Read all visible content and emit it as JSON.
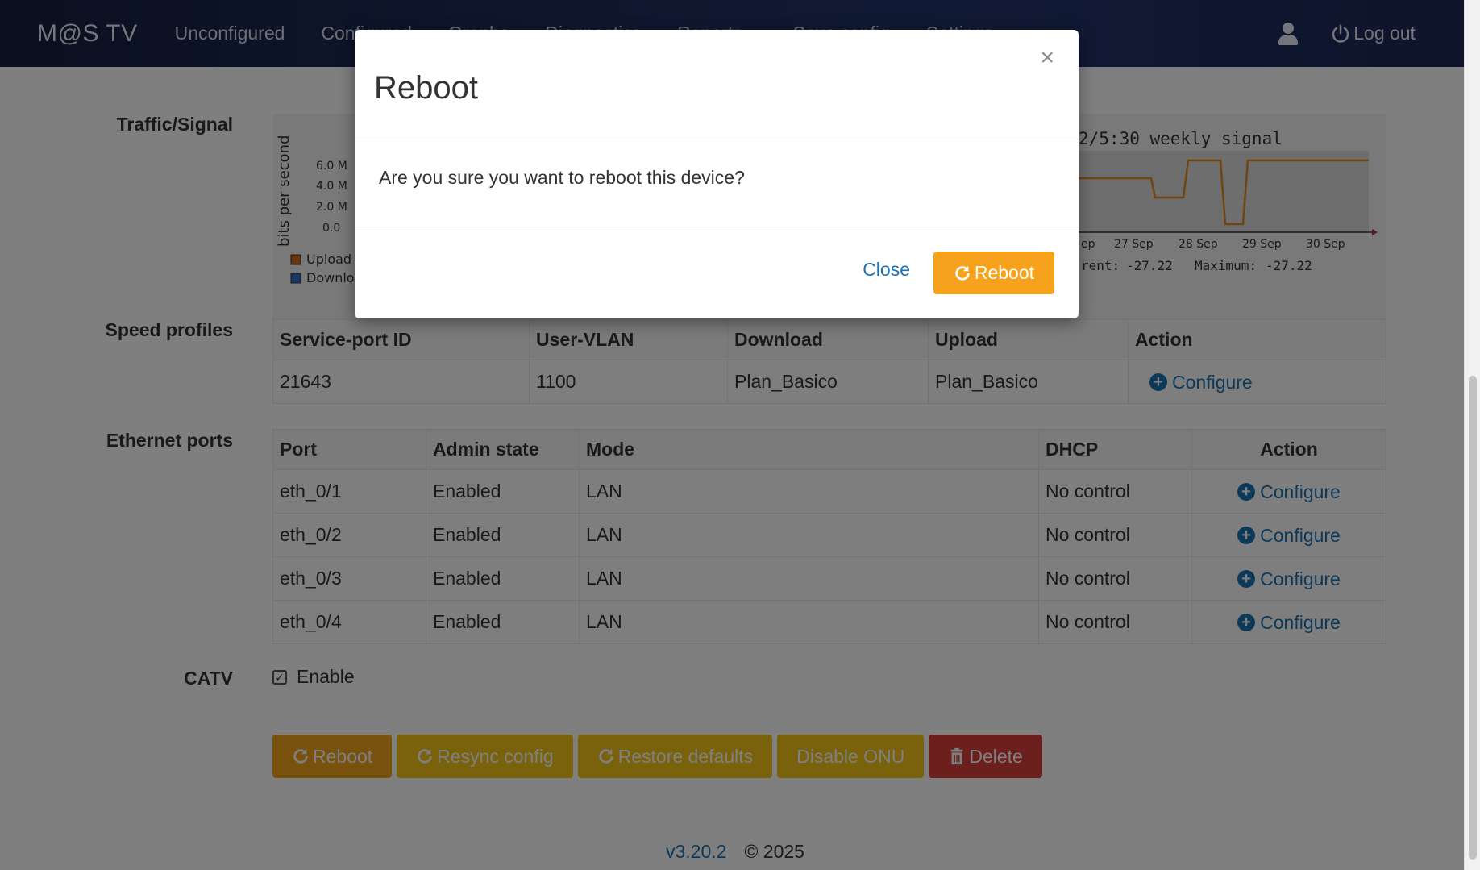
{
  "navbar": {
    "brand": "M@S TV",
    "items": [
      "Unconfigured",
      "Configured",
      "Graphs",
      "Diagnostics",
      "Reports",
      "Save config",
      "Settings"
    ],
    "logout": "Log out"
  },
  "sections": {
    "traffic_label": "Traffic/Signal",
    "speed_label": "Speed profiles",
    "ethernet_label": "Ethernet ports",
    "catv_label": "CATV"
  },
  "traffic_graph": {
    "ylabel": "bits per second",
    "yticks": [
      "6.0 M",
      "4.0 M",
      "2.0 M",
      "0.0"
    ],
    "legend": [
      "Upload",
      "Download"
    ],
    "upload_color": "#d86c1a",
    "download_color": "#3a6fc9"
  },
  "signal_graph": {
    "title_fragment": "2/5:30 weekly signal",
    "xticks": [
      "ep",
      "27 Sep",
      "28 Sep",
      "29 Sep",
      "30 Sep"
    ],
    "current_label": "rent:",
    "current_value": "-27.22",
    "maximum_label": "Maximum:",
    "maximum_value": "-27.22",
    "line_color": "#e28a1e"
  },
  "speed_profiles": {
    "headers": [
      "Service-port ID",
      "User-VLAN",
      "Download",
      "Upload",
      "Action"
    ],
    "rows": [
      {
        "id": "21643",
        "vlan": "1100",
        "download": "Plan_Basico",
        "upload": "Plan_Basico",
        "action": "Configure"
      }
    ]
  },
  "ethernet_ports": {
    "headers": [
      "Port",
      "Admin state",
      "Mode",
      "DHCP",
      "Action"
    ],
    "rows": [
      {
        "port": "eth_0/1",
        "state": "Enabled",
        "mode": "LAN",
        "dhcp": "No control",
        "action": "Configure"
      },
      {
        "port": "eth_0/2",
        "state": "Enabled",
        "mode": "LAN",
        "dhcp": "No control",
        "action": "Configure"
      },
      {
        "port": "eth_0/3",
        "state": "Enabled",
        "mode": "LAN",
        "dhcp": "No control",
        "action": "Configure"
      },
      {
        "port": "eth_0/4",
        "state": "Enabled",
        "mode": "LAN",
        "dhcp": "No control",
        "action": "Configure"
      }
    ]
  },
  "catv": {
    "checkbox_label": "Enable",
    "checked": true
  },
  "actions": {
    "reboot": "Reboot",
    "resync": "Resync config",
    "restore": "Restore defaults",
    "disable": "Disable ONU",
    "delete": "Delete"
  },
  "footer": {
    "version": "v3.20.2",
    "copyright": "© 2025"
  },
  "modal": {
    "title": "Reboot",
    "close_symbol": "×",
    "message": "Are you sure you want to reboot this device?",
    "close_label": "Close",
    "confirm_label": "Reboot"
  }
}
